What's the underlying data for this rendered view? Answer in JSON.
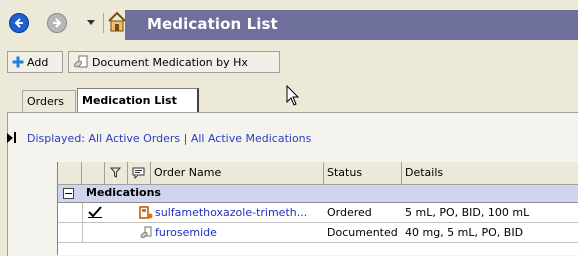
{
  "window": {
    "title": "Medication List"
  },
  "toolbar": {
    "add_label": "Add",
    "document_label": "Document Medication by Hx"
  },
  "tabs": [
    {
      "label": "Orders",
      "active": false
    },
    {
      "label": "Medication List",
      "active": true
    }
  ],
  "filter": {
    "text": "Displayed: All Active Orders | All Active Medications"
  },
  "grid": {
    "columns": {
      "order_name": "Order Name",
      "status": "Status",
      "details": "Details"
    },
    "group": {
      "title": "Medications"
    },
    "rows": [
      {
        "checked": true,
        "icon": "order-pending-icon",
        "order_name": "sulfamethoxazole-trimeth...",
        "status": "Ordered",
        "details": "5 mL, PO, BID, 100 mL"
      },
      {
        "checked": false,
        "icon": "document-medication-icon",
        "order_name": "furosemide",
        "status": "Documented",
        "details": "40 mg, 5 mL, PO, BID"
      }
    ]
  },
  "colors": {
    "titlebar": "#6e6f9a",
    "group_row": "#cfd4ef",
    "link": "#1d2fc2"
  }
}
